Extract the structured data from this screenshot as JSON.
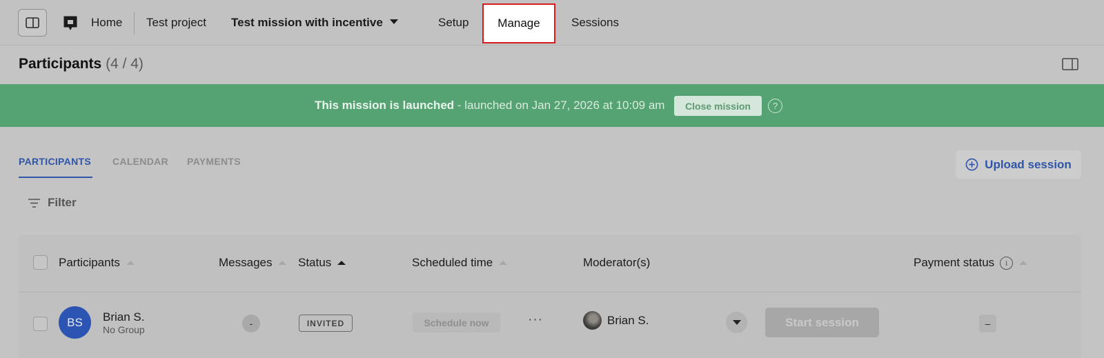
{
  "nav": {
    "home": "Home",
    "project": "Test project",
    "mission": "Test mission with incentive",
    "tabs": {
      "setup": "Setup",
      "manage": "Manage",
      "sessions": "Sessions"
    },
    "highlight_color": "#d6191c"
  },
  "header": {
    "title": "Participants",
    "count": "(4 / 4)"
  },
  "banner": {
    "status": "This mission is launched",
    "detail": " - launched on Jan 27, 2026 at 10:09 am",
    "close_label": "Close mission",
    "help": "?",
    "color": "#55a272"
  },
  "subtabs": {
    "participants": "PARTICIPANTS",
    "calendar": "CALENDAR",
    "payments": "PAYMENTS"
  },
  "upload_label": "Upload session",
  "filter_label": "Filter",
  "table": {
    "columns": {
      "participants": "Participants",
      "messages": "Messages",
      "status": "Status",
      "scheduled": "Scheduled time",
      "moderators": "Moderator(s)",
      "payment": "Payment status"
    },
    "info_glyph": "i",
    "rows": [
      {
        "initials": "BS",
        "name": "Brian S.",
        "group": "No Group",
        "messages": "-",
        "status": "INVITED",
        "schedule_label": "Schedule now",
        "more": "···",
        "moderator": "Brian S.",
        "start_label": "Start session",
        "payment": "–"
      }
    ]
  },
  "icons": {
    "sidebar_toggle": "panel-left-icon",
    "logo": "chat-logo-icon",
    "right_panel": "panel-right-icon",
    "upload": "plus-circle-icon",
    "filter": "filter-lines-icon"
  }
}
